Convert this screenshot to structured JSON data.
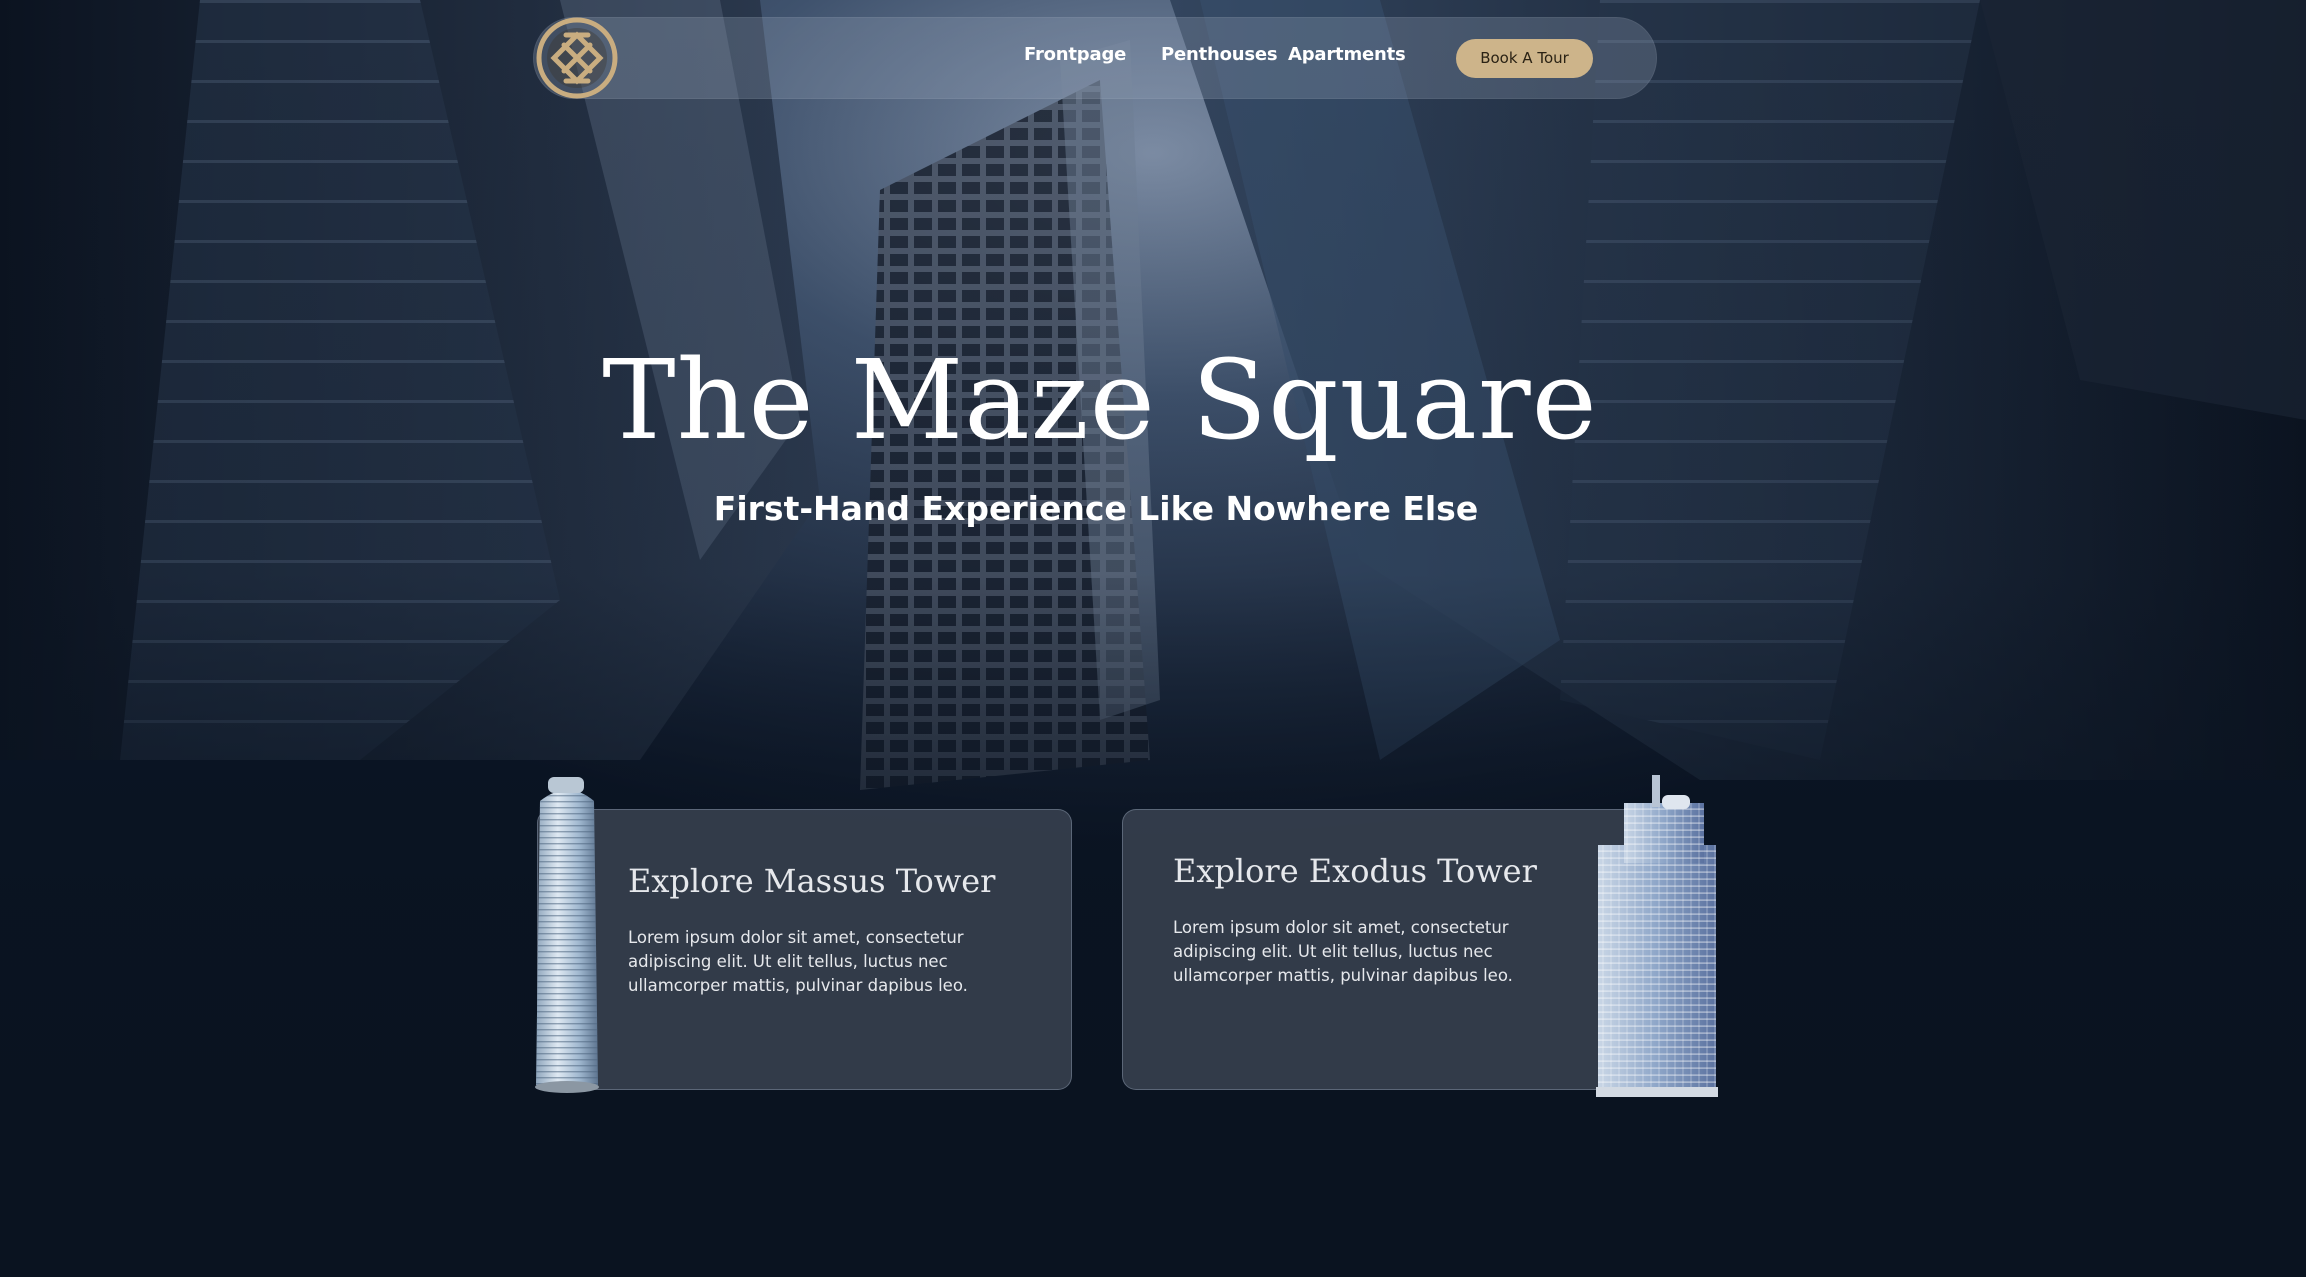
{
  "nav": {
    "logo_name": "celtic-knot-logo",
    "links": [
      {
        "label": "Frontpage"
      },
      {
        "label": "Penthouses"
      },
      {
        "label": "Apartments"
      }
    ],
    "cta_label": "Book A Tour"
  },
  "hero": {
    "title": "The Maze Square",
    "subtitle": "First-Hand Experience Like Nowhere Else"
  },
  "cards": [
    {
      "title": "Explore Massus Tower",
      "text": "Lorem ipsum dolor sit amet, consectetur adipiscing elit. Ut elit tellus, luctus nec ullamcorper mattis, pulvinar dapibus leo.",
      "image": "cylindrical-glass-tower"
    },
    {
      "title": "Explore Exodus Tower",
      "text": "Lorem ipsum dolor sit amet, consectetur adipiscing elit. Ut elit tellus, luctus nec ullamcorper mattis, pulvinar dapibus leo.",
      "image": "stepped-glass-skyscraper"
    }
  ],
  "colors": {
    "accent_gold": "#cdb48a",
    "background_dark": "#0a1320",
    "card_bg": "#3e4654",
    "text_light": "#e6e8ec"
  }
}
